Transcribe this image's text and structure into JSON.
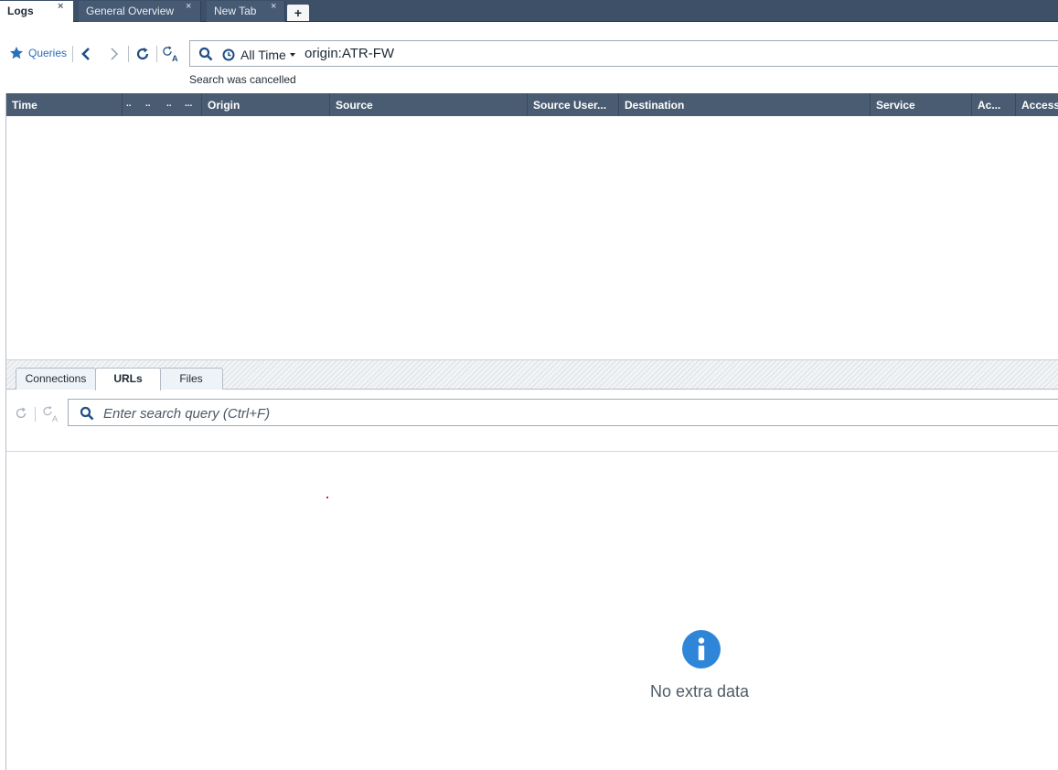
{
  "tabs": [
    {
      "label": "Logs",
      "close": "×",
      "active": true
    },
    {
      "label": "General Overview",
      "close": "×",
      "active": false
    },
    {
      "label": "New Tab",
      "close": "×",
      "active": false
    }
  ],
  "new_tab_label": "+",
  "toolbar": {
    "queries_label": "Queries",
    "time_range": "All Time",
    "query": "origin:ATR-FW",
    "status": "Search was cancelled"
  },
  "grid": {
    "columns": [
      "Time",
      "..",
      "..",
      "..",
      "...",
      "Origin",
      "Source",
      "Source User...",
      "Destination",
      "Service",
      "Ac...",
      "Access"
    ],
    "rows": []
  },
  "details": {
    "tabs": [
      "Connections",
      "URLs",
      "Files"
    ],
    "active_tab": "URLs",
    "search_placeholder": "Enter search query (Ctrl+F)",
    "empty_message": "No extra data"
  },
  "colors": {
    "tabstrip": "#3d5068",
    "grid_header": "#4a5c72",
    "accent_blue": "#2a6fbb",
    "info_icon": "#2f86d8"
  },
  "icons": [
    "star-icon",
    "back-icon",
    "forward-icon",
    "refresh-icon",
    "auto-refresh-icon",
    "search-icon",
    "clock-icon",
    "info-icon"
  ]
}
